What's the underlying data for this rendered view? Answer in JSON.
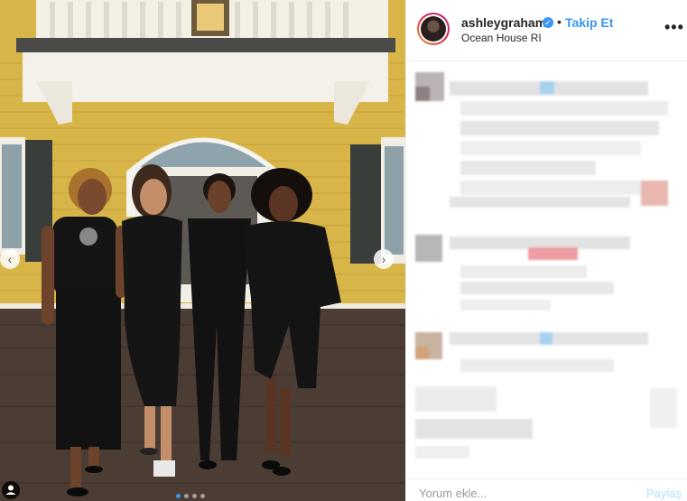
{
  "post": {
    "username": "ashleygraham",
    "verified_icon": "verified-badge-icon",
    "separator": "•",
    "follow_label": "Takip Et",
    "location": "Ocean House RI",
    "more_icon": "more-options-icon"
  },
  "photo": {
    "prev_arrow": "‹",
    "next_arrow": "›",
    "carousel_dots": 4,
    "active_dot": 0
  },
  "comment_box": {
    "placeholder": "Yorum ekle...",
    "post_label": "Paylaş"
  },
  "colors": {
    "accent": "#3897f0",
    "wall": "#d9b64a",
    "deck": "#4a3b33"
  }
}
